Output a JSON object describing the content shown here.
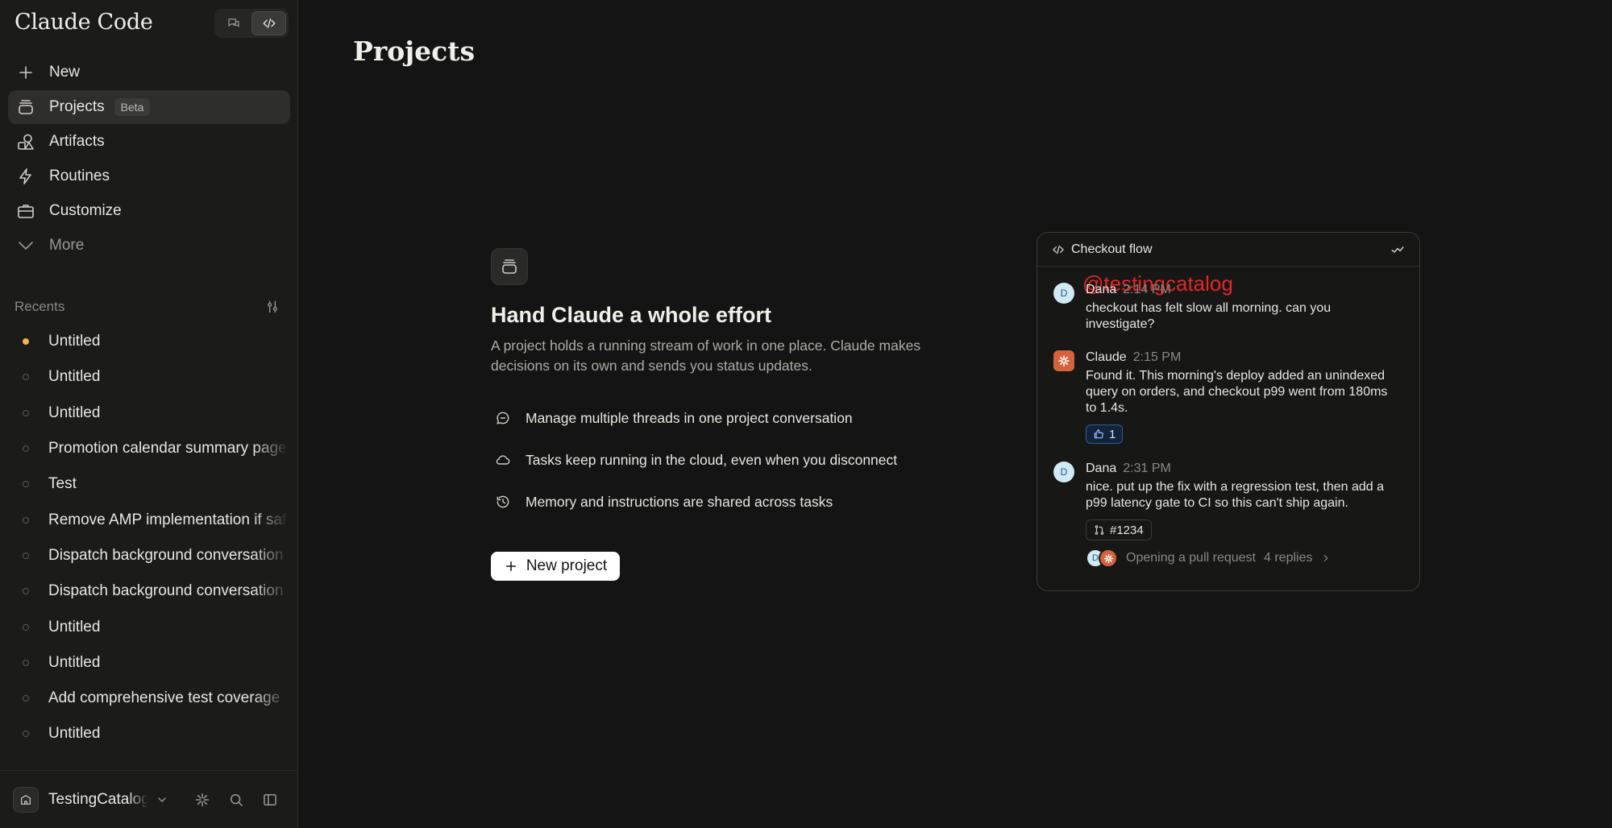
{
  "sidebar": {
    "app_title": "Claude Code",
    "nav": [
      {
        "label": "New",
        "icon": "plus-icon"
      },
      {
        "label": "Projects",
        "icon": "projects-icon",
        "badge": "Beta"
      },
      {
        "label": "Artifacts",
        "icon": "artifacts-icon"
      },
      {
        "label": "Routines",
        "icon": "lightning-icon"
      },
      {
        "label": "Customize",
        "icon": "briefcase-icon"
      },
      {
        "label": "More",
        "icon": "chevron-down-icon"
      }
    ],
    "recents_label": "Recents",
    "recents": [
      {
        "label": "Untitled",
        "live": true
      },
      {
        "label": "Untitled"
      },
      {
        "label": "Untitled"
      },
      {
        "label": "Promotion calendar summary page"
      },
      {
        "label": "Test"
      },
      {
        "label": "Remove AMP implementation if safe"
      },
      {
        "label": "Dispatch background conversation"
      },
      {
        "label": "Dispatch background conversation"
      },
      {
        "label": "Untitled"
      },
      {
        "label": "Untitled"
      },
      {
        "label": "Add comprehensive test coverage"
      },
      {
        "label": "Untitled"
      }
    ],
    "org_name": "TestingCatalog"
  },
  "main": {
    "page_title": "Projects",
    "hero": {
      "title": "Hand Claude a whole effort",
      "description": "A project holds a running stream of work in one place. Claude makes decisions on its own and sends you status updates.",
      "features": [
        {
          "label": "Manage multiple threads in one project conversation",
          "icon": "chat-bubble-icon"
        },
        {
          "label": "Tasks keep running in the cloud, even when you disconnect",
          "icon": "cloud-icon"
        },
        {
          "label": "Memory and instructions are shared across tasks",
          "icon": "history-icon"
        }
      ],
      "new_project_label": "New project"
    },
    "preview": {
      "title": "Checkout flow",
      "watermark": "@testingcatalog",
      "messages": [
        {
          "author": "Dana",
          "initial": "D",
          "time": "2:14 PM",
          "text": "checkout has felt slow all morning. can you investigate?"
        },
        {
          "author": "Claude",
          "time": "2:15 PM",
          "text": "Found it. This morning's deploy added an unindexed query on orders, and checkout p99 went from 180ms to 1.4s.",
          "reaction_count": "1"
        },
        {
          "author": "Dana",
          "initial": "D",
          "time": "2:31 PM",
          "text": "nice. put up the fix with a regression test, then add a p99 latency gate to CI so this can't ship again.",
          "pr_label": "#1234",
          "thread_status": "Opening a pull request",
          "thread_replies": "4 replies"
        }
      ]
    }
  },
  "colors": {
    "background": "#141414",
    "sidebar": "#1b1b1a",
    "accent_claude": "#d4623f",
    "live_dot": "#f0b44a",
    "watermark": "#e02828"
  }
}
